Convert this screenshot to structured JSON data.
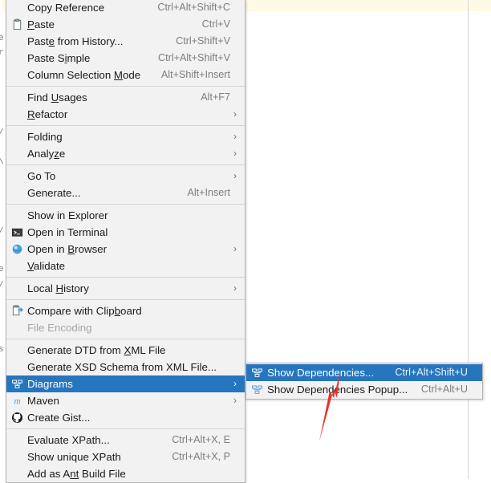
{
  "editor": {
    "ghost_lines": [
      "e",
      "r",
      "/",
      "\\",
      "/",
      "e",
      "/",
      "s"
    ],
    "caret_line_color": "#fffae3",
    "margin_guide_color": "#d7d7d7"
  },
  "context_menu": {
    "name": "editor-context-menu",
    "accent_color": "#2675bf",
    "background": "#f2f2f2",
    "groups": [
      {
        "items": [
          {
            "id": "copy-reference",
            "label": "Copy Reference",
            "accel": "Ctrl+Alt+Shift+C",
            "icon": "",
            "submenu": false,
            "disabled": false,
            "selected": false
          },
          {
            "id": "paste",
            "label": "Paste",
            "accel": "Ctrl+V",
            "icon": "clipboard-icon",
            "submenu": false,
            "disabled": false,
            "selected": false,
            "mnemonic": "P"
          },
          {
            "id": "paste-from-history",
            "label": "Paste from History...",
            "accel": "Ctrl+Shift+V",
            "icon": "",
            "submenu": false,
            "disabled": false,
            "selected": false,
            "mnemonic": "e"
          },
          {
            "id": "paste-simple",
            "label": "Paste Simple",
            "accel": "Ctrl+Alt+Shift+V",
            "icon": "",
            "submenu": false,
            "disabled": false,
            "selected": false,
            "mnemonic": "i"
          },
          {
            "id": "column-selection-mode",
            "label": "Column Selection Mode",
            "accel": "Alt+Shift+Insert",
            "icon": "",
            "submenu": false,
            "disabled": false,
            "selected": false,
            "mnemonic": "M"
          }
        ]
      },
      {
        "items": [
          {
            "id": "find-usages",
            "label": "Find Usages",
            "accel": "Alt+F7",
            "icon": "",
            "submenu": false,
            "disabled": false,
            "selected": false,
            "mnemonic": "U"
          },
          {
            "id": "refactor",
            "label": "Refactor",
            "accel": "",
            "icon": "",
            "submenu": true,
            "disabled": false,
            "selected": false,
            "mnemonic": "R"
          }
        ]
      },
      {
        "items": [
          {
            "id": "folding",
            "label": "Folding",
            "accel": "",
            "icon": "",
            "submenu": true,
            "disabled": false,
            "selected": false
          },
          {
            "id": "analyze",
            "label": "Analyze",
            "accel": "",
            "icon": "",
            "submenu": true,
            "disabled": false,
            "selected": false,
            "mnemonic": "z"
          }
        ]
      },
      {
        "items": [
          {
            "id": "go-to",
            "label": "Go To",
            "accel": "",
            "icon": "",
            "submenu": true,
            "disabled": false,
            "selected": false
          },
          {
            "id": "generate",
            "label": "Generate...",
            "accel": "Alt+Insert",
            "icon": "",
            "submenu": false,
            "disabled": false,
            "selected": false
          }
        ]
      },
      {
        "items": [
          {
            "id": "show-in-explorer",
            "label": "Show in Explorer",
            "accel": "",
            "icon": "",
            "submenu": false,
            "disabled": false,
            "selected": false
          },
          {
            "id": "open-in-terminal",
            "label": "Open in Terminal",
            "accel": "",
            "icon": "terminal-icon",
            "submenu": false,
            "disabled": false,
            "selected": false
          },
          {
            "id": "open-in-browser",
            "label": "Open in Browser",
            "accel": "",
            "icon": "browser-globe-icon",
            "submenu": true,
            "disabled": false,
            "selected": false,
            "mnemonic": "B"
          },
          {
            "id": "validate",
            "label": "Validate",
            "accel": "",
            "icon": "",
            "submenu": false,
            "disabled": false,
            "selected": false,
            "mnemonic": "V"
          }
        ]
      },
      {
        "items": [
          {
            "id": "local-history",
            "label": "Local History",
            "accel": "",
            "icon": "",
            "submenu": true,
            "disabled": false,
            "selected": false,
            "mnemonic": "H"
          }
        ]
      },
      {
        "items": [
          {
            "id": "compare-with-clipboard",
            "label": "Compare with Clipboard",
            "accel": "",
            "icon": "compare-clipboard-icon",
            "submenu": false,
            "disabled": false,
            "selected": false,
            "mnemonic": "b"
          },
          {
            "id": "file-encoding",
            "label": "File Encoding",
            "accel": "",
            "icon": "",
            "submenu": false,
            "disabled": true,
            "selected": false
          }
        ]
      },
      {
        "items": [
          {
            "id": "generate-dtd-from-xml-file",
            "label": "Generate DTD from XML File",
            "accel": "",
            "icon": "",
            "submenu": false,
            "disabled": false,
            "selected": false,
            "mnemonic": "X"
          },
          {
            "id": "generate-xsd-schema-from-xml-file",
            "label": "Generate XSD Schema from XML File...",
            "accel": "",
            "icon": "",
            "submenu": false,
            "disabled": false,
            "selected": false
          },
          {
            "id": "diagrams",
            "label": "Diagrams",
            "accel": "",
            "icon": "diagram-icon",
            "submenu": true,
            "disabled": false,
            "selected": true
          },
          {
            "id": "maven",
            "label": "Maven",
            "accel": "",
            "icon": "maven-icon",
            "submenu": true,
            "disabled": false,
            "selected": false
          },
          {
            "id": "create-gist",
            "label": "Create Gist...",
            "accel": "",
            "icon": "github-icon",
            "submenu": false,
            "disabled": false,
            "selected": false
          }
        ]
      },
      {
        "items": [
          {
            "id": "evaluate-xpath",
            "label": "Evaluate XPath...",
            "accel": "Ctrl+Alt+X, E",
            "icon": "",
            "submenu": false,
            "disabled": false,
            "selected": false
          },
          {
            "id": "show-unique-xpath",
            "label": "Show unique XPath",
            "accel": "Ctrl+Alt+X, P",
            "icon": "",
            "submenu": false,
            "disabled": false,
            "selected": false
          },
          {
            "id": "add-as-ant-build-file",
            "label": "Add as Ant Build File",
            "accel": "",
            "icon": "",
            "submenu": false,
            "disabled": false,
            "selected": false,
            "mnemonic": "nt"
          }
        ]
      }
    ]
  },
  "submenu": {
    "name": "diagrams-submenu",
    "parent": "Diagrams",
    "items": [
      {
        "id": "show-dependencies",
        "label": "Show Dependencies...",
        "accel": "Ctrl+Alt+Shift+U",
        "icon": "diagram-icon",
        "selected": true
      },
      {
        "id": "show-dependencies-popup",
        "label": "Show Dependencies Popup...",
        "accel": "Ctrl+Alt+U",
        "icon": "diagram-icon",
        "selected": false
      }
    ]
  },
  "annotation": {
    "arrow_color": "#e8302a",
    "points_at": "Show Dependencies..."
  }
}
